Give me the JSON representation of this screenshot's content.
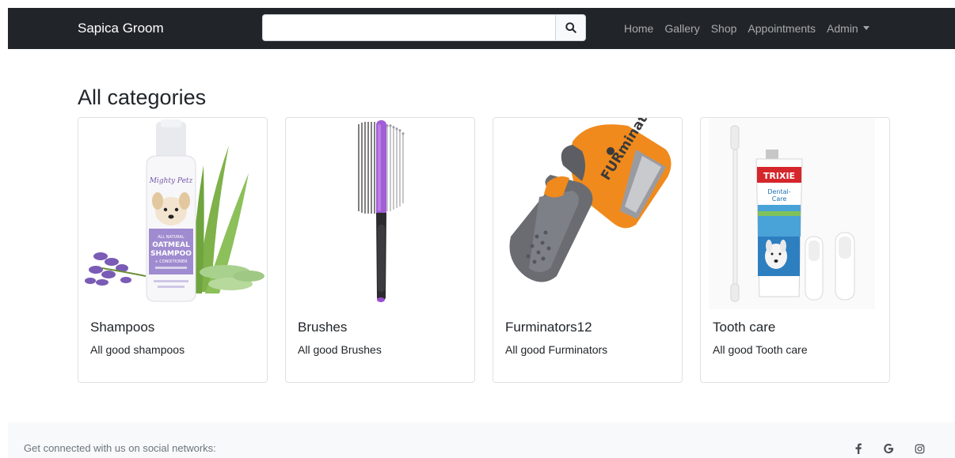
{
  "navbar": {
    "brand": "Sapica Groom",
    "search": {
      "value": "",
      "placeholder": ""
    },
    "search_icon": "search-icon",
    "links": [
      "Home",
      "Gallery",
      "Shop",
      "Appointments",
      "Admin"
    ],
    "background": "#212529"
  },
  "main": {
    "title": "All categories",
    "categories": [
      {
        "name": "Shampoos",
        "description": "All good shampoos",
        "image": "shampoo-bottle"
      },
      {
        "name": "Brushes",
        "description": "All good Brushes",
        "image": "pet-brush"
      },
      {
        "name": "Furminators12",
        "description": "All good Furminators",
        "image": "furminator-tool"
      },
      {
        "name": "Tooth care",
        "description": "All good Tooth care",
        "image": "toothpaste-kit"
      }
    ]
  },
  "footer": {
    "text": "Get connected with us on social networks:",
    "icons": [
      "facebook-icon",
      "google-icon",
      "instagram-icon"
    ],
    "background": "#f8f9fa"
  }
}
